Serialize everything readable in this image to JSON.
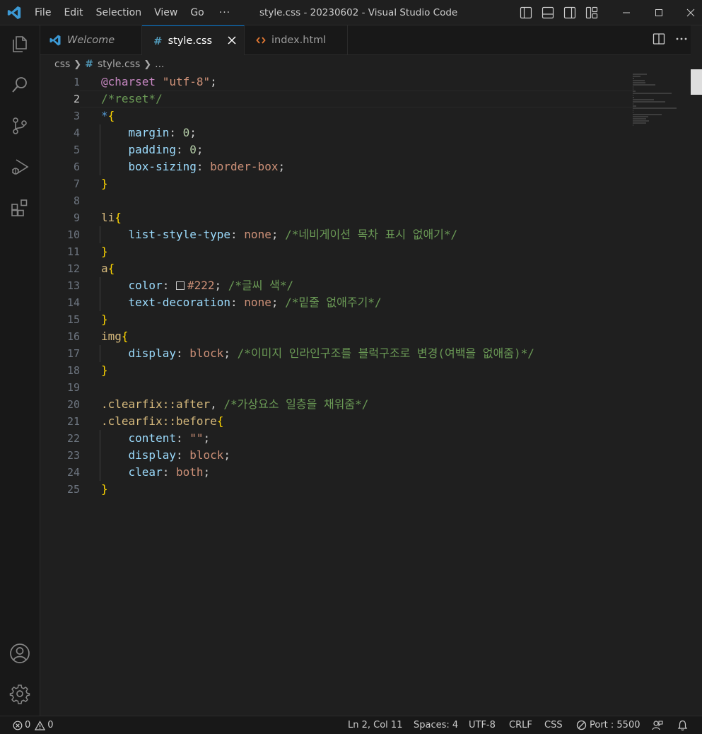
{
  "titlebar": {
    "menu": [
      "File",
      "Edit",
      "Selection",
      "View",
      "Go"
    ],
    "more": "···",
    "title": "style.css - 20230602 - Visual Studio Code"
  },
  "tabs": [
    {
      "label": "Welcome",
      "icon": "vscode-logo-icon",
      "active": false
    },
    {
      "label": "style.css",
      "icon": "hash-icon",
      "active": true
    },
    {
      "label": "index.html",
      "icon": "html-brackets-icon",
      "active": false
    }
  ],
  "breadcrumb": {
    "folder": "css",
    "file": "style.css",
    "symbol": "..."
  },
  "editor": {
    "current_line": 2,
    "lines": [
      {
        "n": "1"
      },
      {
        "n": "2"
      },
      {
        "n": "3"
      },
      {
        "n": "4"
      },
      {
        "n": "5"
      },
      {
        "n": "6"
      },
      {
        "n": "7"
      },
      {
        "n": "8"
      },
      {
        "n": "9"
      },
      {
        "n": "10"
      },
      {
        "n": "11"
      },
      {
        "n": "12"
      },
      {
        "n": "13"
      },
      {
        "n": "14"
      },
      {
        "n": "15"
      },
      {
        "n": "16"
      },
      {
        "n": "17"
      },
      {
        "n": "18"
      },
      {
        "n": "19"
      },
      {
        "n": "20"
      },
      {
        "n": "21"
      },
      {
        "n": "22"
      },
      {
        "n": "23"
      },
      {
        "n": "24"
      },
      {
        "n": "25"
      }
    ],
    "code": {
      "l1_at": "@charset",
      "l1_str": "\"utf-8\"",
      "l2_com": "/*reset*/",
      "l3_star": "*",
      "l4_prop": "margin",
      "l4_val": "0",
      "l5_prop": "padding",
      "l5_val": "0",
      "l6_prop": "box-sizing",
      "l6_val": "border-box",
      "l9_sel": "li",
      "l10_prop": "list-style-type",
      "l10_val": "none",
      "l10_com": "/*네비게이션 목차 표시 없애기*/",
      "l12_sel": "a",
      "l13_prop": "color",
      "l13_val": "#222",
      "l13_com": "/*글씨 색*/",
      "l14_prop": "text-decoration",
      "l14_val": "none",
      "l14_com": "/*밑줄 없애주기*/",
      "l16_sel": "img",
      "l17_prop": "display",
      "l17_val": "block",
      "l17_com": "/*이미지 인라인구조를 블럭구조로 변경(여백을 없애줌)*/",
      "l20_sel": ".clearfix::after",
      "l20_com": "/*가상요소 일층을 채워줌*/",
      "l21_sel": ".clearfix::before",
      "l22_prop": "content",
      "l22_val": "\"\"",
      "l23_prop": "display",
      "l23_val": "block",
      "l24_prop": "clear",
      "l24_val": "both"
    }
  },
  "statusbar": {
    "errors": "0",
    "warnings": "0",
    "position": "Ln 2, Col 11",
    "spaces": "Spaces: 4",
    "encoding": "UTF-8",
    "eol": "CRLF",
    "language": "CSS",
    "port": "Port : 5500"
  },
  "colors": {
    "accent": "#0078d4",
    "background": "#1f1f1f",
    "comment": "#6a9955",
    "property": "#9cdcfe",
    "value": "#ce9178",
    "brace": "#ffd700"
  }
}
